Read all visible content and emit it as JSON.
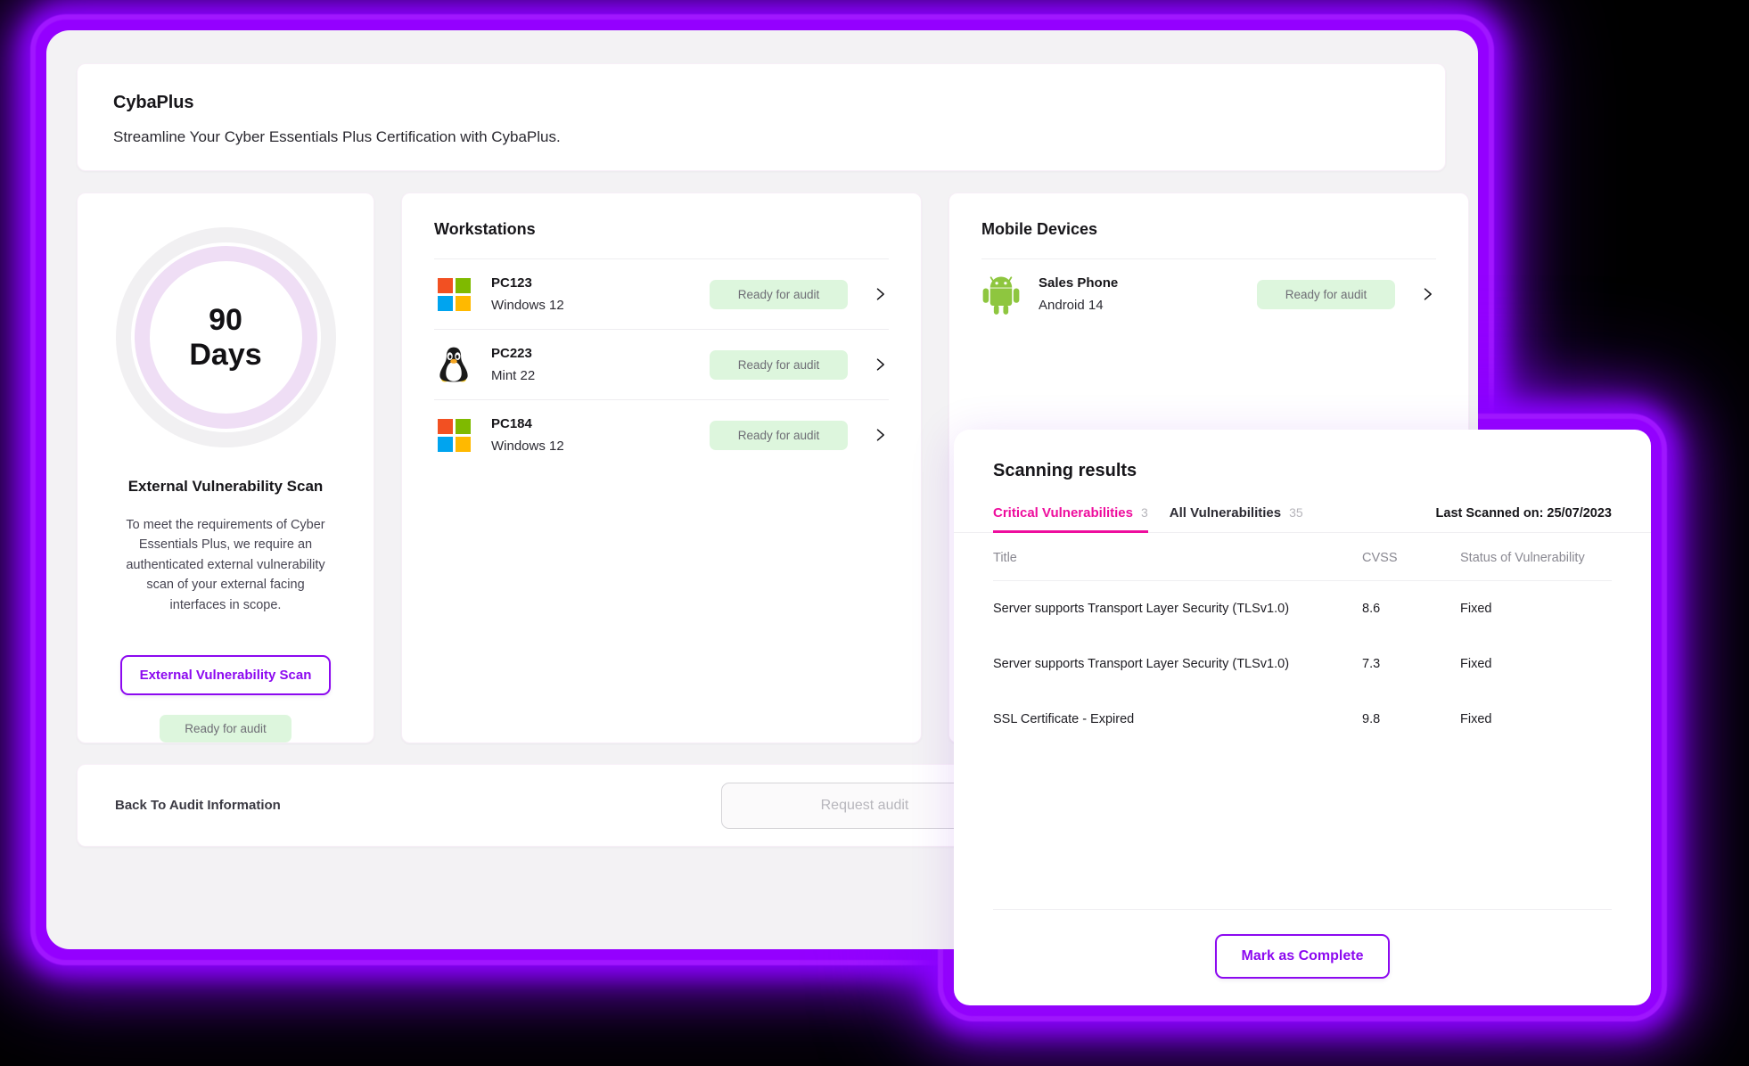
{
  "app": {
    "title": "CybaPlus",
    "subtitle": "Streamline Your Cyber Essentials Plus Certification with CybaPlus."
  },
  "scan_panel": {
    "days_number": "90",
    "days_unit": "Days",
    "title": "External Vulnerability Scan",
    "description": "To meet the requirements of Cyber Essentials Plus, we require an authenticated external vulnerability scan of your external facing interfaces in scope.",
    "button_label": "External  Vulnerability Scan",
    "status_badge": "Ready for audit"
  },
  "workstations": {
    "title": "Workstations",
    "items": [
      {
        "name": "PC123",
        "os": "Windows 12",
        "status": "Ready for audit",
        "icon": "windows-icon"
      },
      {
        "name": "PC223",
        "os": "Mint 22",
        "status": "Ready for audit",
        "icon": "linux-icon"
      },
      {
        "name": "PC184",
        "os": "Windows 12",
        "status": "Ready for audit",
        "icon": "windows-icon"
      }
    ]
  },
  "mobile_devices": {
    "title": "Mobile Devices",
    "items": [
      {
        "name": "Sales Phone",
        "os": "Android 14",
        "status": "Ready for audit",
        "icon": "android-icon"
      }
    ]
  },
  "footer": {
    "back_label": "Back To Audit Information",
    "request_label": "Request audit"
  },
  "modal": {
    "title": "Scanning results",
    "tabs": [
      {
        "label": "Critical Vulnerabilities",
        "count": "3",
        "active": true
      },
      {
        "label": "All Vulnerabilities",
        "count": "35",
        "active": false
      }
    ],
    "last_scanned": "Last Scanned on: 25/07/2023",
    "columns": [
      "Title",
      "CVSS",
      "Status of Vulnerability"
    ],
    "rows": [
      {
        "title": "Server supports Transport Layer Security (TLSv1.0)",
        "cvss": "8.6",
        "status": "Fixed"
      },
      {
        "title": "Server supports Transport Layer Security (TLSv1.0)",
        "cvss": "7.3",
        "status": "Fixed"
      },
      {
        "title": "SSL Certificate - Expired",
        "cvss": "9.8",
        "status": "Fixed"
      }
    ],
    "complete_label": "Mark as Complete"
  },
  "colors": {
    "glow_purple": "#9400ff",
    "accent_purple": "#8c09f0",
    "tab_magenta": "#ee0d9d",
    "badge_green_bg": "#ddf6dd",
    "page_bg": "#f3f2f4",
    "windows_red": "#f25022",
    "windows_green": "#7fba00",
    "windows_blue": "#00a4ef",
    "windows_yellow": "#ffb900",
    "android_green": "#8ec63f"
  }
}
